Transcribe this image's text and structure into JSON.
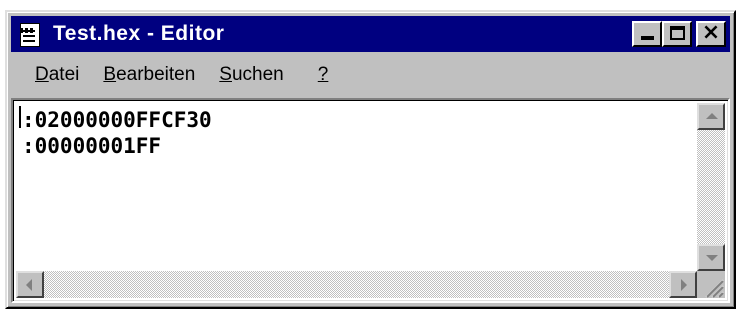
{
  "window": {
    "title": "Test.hex - Editor",
    "buttons": {
      "minimize": "minimize",
      "maximize": "maximize",
      "close": "×"
    }
  },
  "menu": {
    "items": [
      {
        "accel": "D",
        "rest": "atei"
      },
      {
        "accel": "B",
        "rest": "earbeiten"
      },
      {
        "accel": "S",
        "rest": "uchen"
      },
      {
        "accel": "?",
        "rest": ""
      }
    ]
  },
  "editor": {
    "lines": [
      ":02000000FFCF30",
      ":00000001FF"
    ]
  },
  "icons": {
    "app": "notepad-icon",
    "scroll_up": "arrow-up-icon",
    "scroll_down": "arrow-down-icon",
    "scroll_left": "arrow-left-icon",
    "scroll_right": "arrow-right-icon",
    "size_grip": "size-grip-icon"
  },
  "colors": {
    "titlebar": "#000080",
    "face": "#c0c0c0",
    "text_background": "#ffffff"
  }
}
